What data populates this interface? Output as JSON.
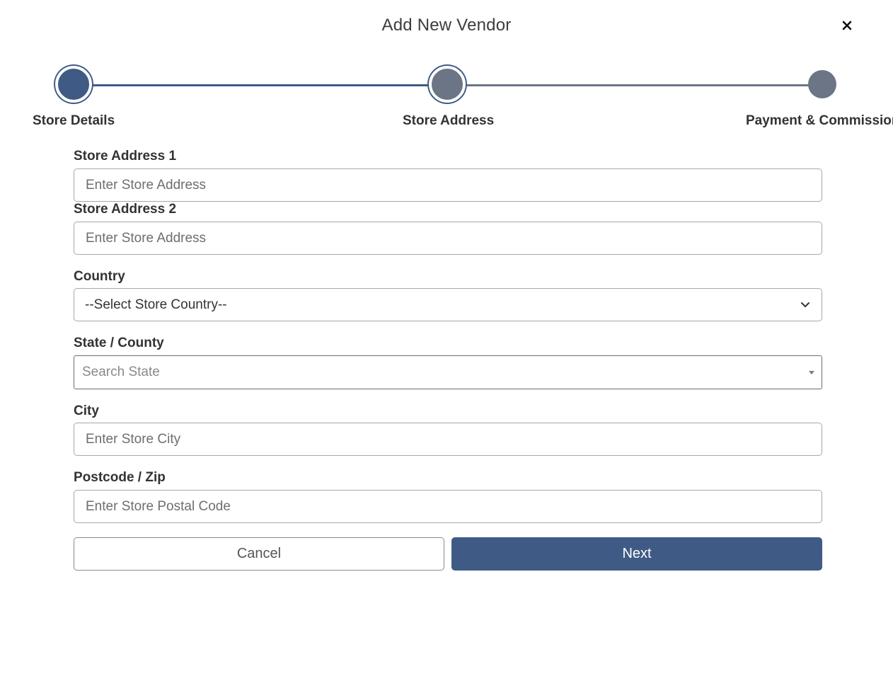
{
  "modal": {
    "title": "Add New Vendor",
    "close_icon": "close-icon"
  },
  "stepper": {
    "steps": [
      {
        "label": "Store Details",
        "state": "completed"
      },
      {
        "label": "Store Address",
        "state": "current"
      },
      {
        "label": "Payment & Commission",
        "state": "upcoming"
      }
    ],
    "colors": {
      "active": "#3f5b85",
      "inactive": "#6c7585"
    }
  },
  "form": {
    "address1": {
      "label": "Store Address 1",
      "placeholder": "Enter Store Address",
      "value": ""
    },
    "address2": {
      "label": "Store Address 2",
      "placeholder": "Enter Store Address",
      "value": ""
    },
    "country": {
      "label": "Country",
      "selected": "--Select Store Country--",
      "icon": "chevron-down-icon"
    },
    "state": {
      "label": "State / County",
      "placeholder": "Search State",
      "icon": "caret-down-icon"
    },
    "city": {
      "label": "City",
      "placeholder": "Enter Store City",
      "value": ""
    },
    "postcode": {
      "label": "Postcode / Zip",
      "placeholder": "Enter Store Postal Code",
      "value": ""
    }
  },
  "actions": {
    "cancel_label": "Cancel",
    "next_label": "Next",
    "primary_color": "#3f5b85"
  }
}
